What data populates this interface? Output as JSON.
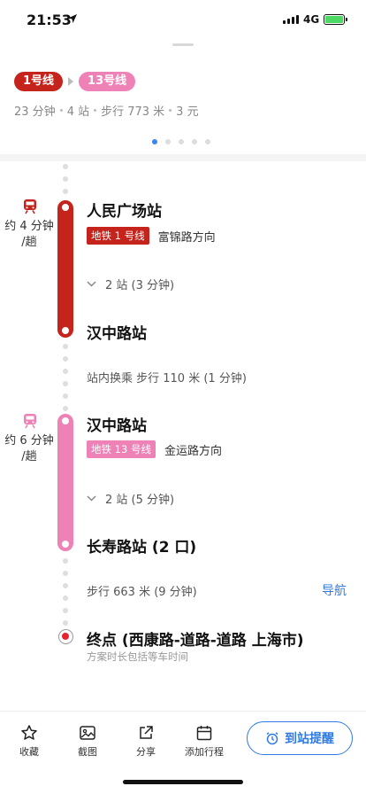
{
  "status_bar": {
    "time": "21:53",
    "network": "4G"
  },
  "summary": {
    "lines": [
      {
        "label": "1号线",
        "color": "#c4241c"
      },
      {
        "label": "13号线",
        "color": "#ee81b6"
      }
    ],
    "duration": "23 分钟",
    "stations": "4 站",
    "walk": "步行 773 米",
    "fare": "3 元"
  },
  "pager": {
    "count": 5,
    "active": 0
  },
  "segment1": {
    "icon": "subway-icon",
    "wait": "约 4 分钟",
    "freq": "/趟",
    "board_station": "人民广场站",
    "line_tag": "地铁 1 号线",
    "direction": "富锦路方向",
    "stops": "2 站 (3 分钟)",
    "alight_station": "汉中路站"
  },
  "transfer": {
    "text": "站内换乘 步行 110 米 (1 分钟)"
  },
  "segment2": {
    "icon": "subway-icon",
    "wait": "约 6 分钟",
    "freq": "/趟",
    "board_station": "汉中路站",
    "line_tag": "地铁 13 号线",
    "direction": "金运路方向",
    "stops": "2 站 (5 分钟)",
    "alight_station": "长寿路站 (2 口)"
  },
  "walk_final": {
    "text": "步行 663 米 (9 分钟)",
    "nav_label": "导航"
  },
  "destination": {
    "title": "终点 (西康路-道路-道路 上海市)",
    "note": "方案时长包括等车时间"
  },
  "toolbar": {
    "favorite": "收藏",
    "screenshot": "截图",
    "share": "分享",
    "add_trip": "添加行程",
    "remind": "到站提醒"
  }
}
